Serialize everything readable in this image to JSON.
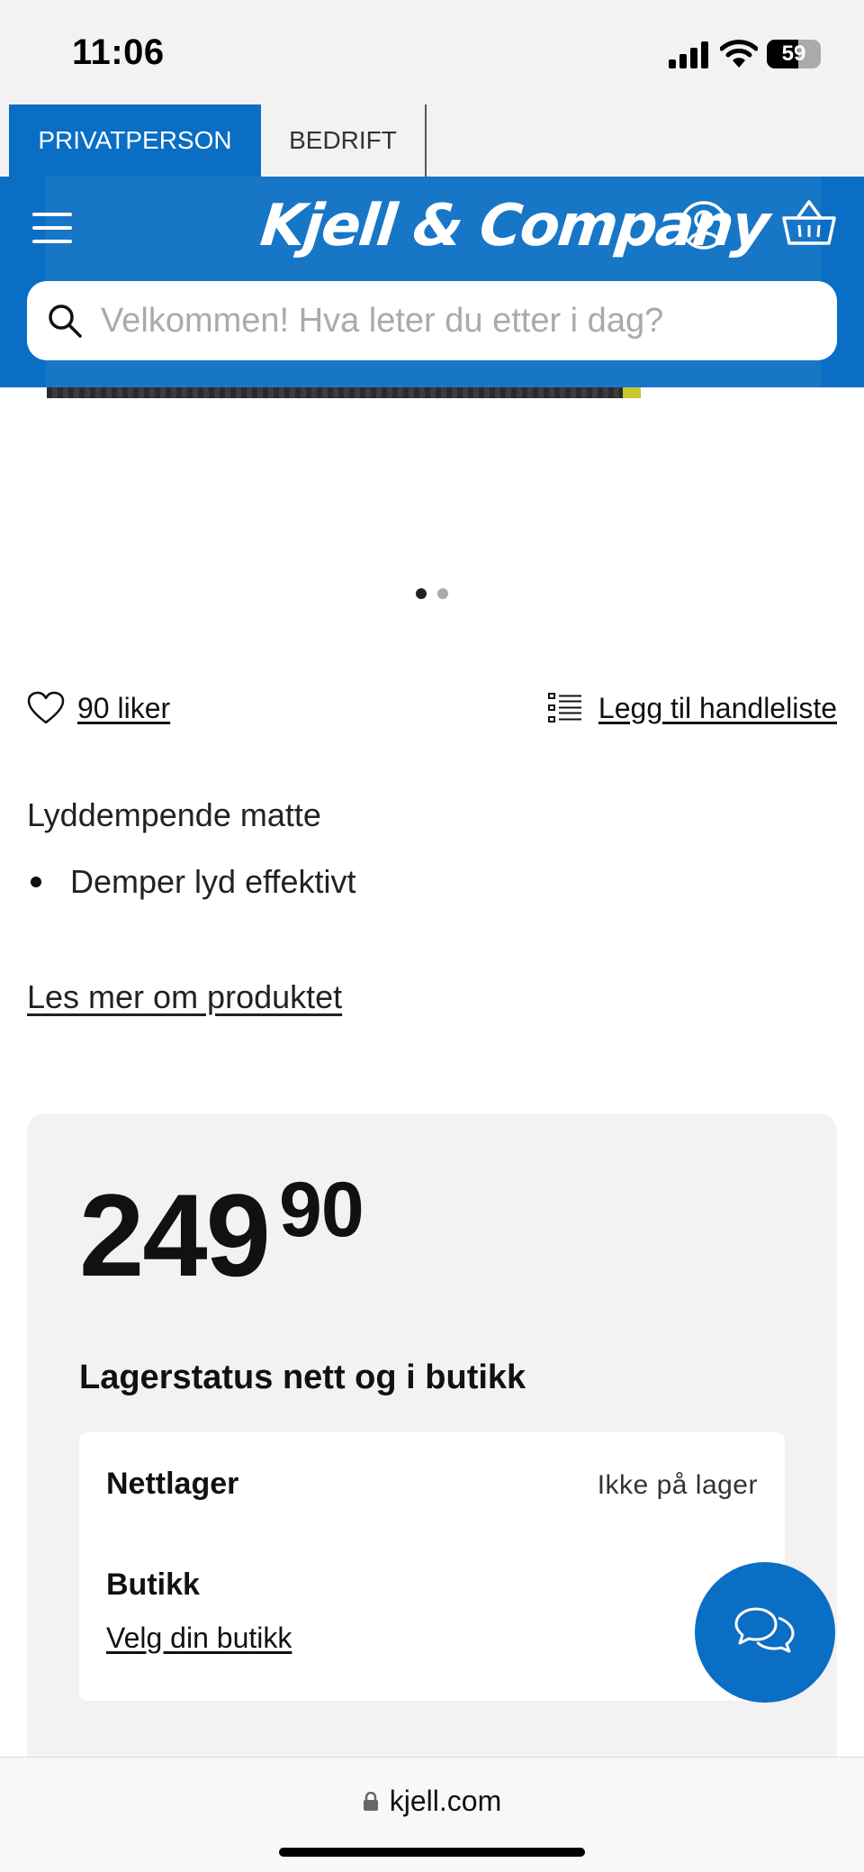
{
  "status_bar": {
    "time": "11:06",
    "battery": "59"
  },
  "segments": {
    "private": "PRIVATPERSON",
    "business": "BEDRIFT"
  },
  "header": {
    "logo": "Kjell & Company",
    "search_placeholder": "Velkommen! Hva leter du etter i dag?",
    "brand_color": "#0a6ec4"
  },
  "carousel": {
    "total": 2,
    "active": 1
  },
  "actions": {
    "likes": "90 liker",
    "shopping_list": "Legg til handleliste"
  },
  "product": {
    "description": "Lyddempende matte",
    "bullets": [
      "Demper lyd effektivt"
    ],
    "read_more": "Les mer om produktet"
  },
  "price": {
    "whole": "249",
    "decimals": "90"
  },
  "stock": {
    "heading": "Lagerstatus nett og i butikk",
    "online_label": "Nettlager",
    "online_value": "Ikke på lager",
    "store_label": "Butikk",
    "store_link": "Velg din butikk"
  },
  "browser": {
    "url": "kjell.com"
  }
}
